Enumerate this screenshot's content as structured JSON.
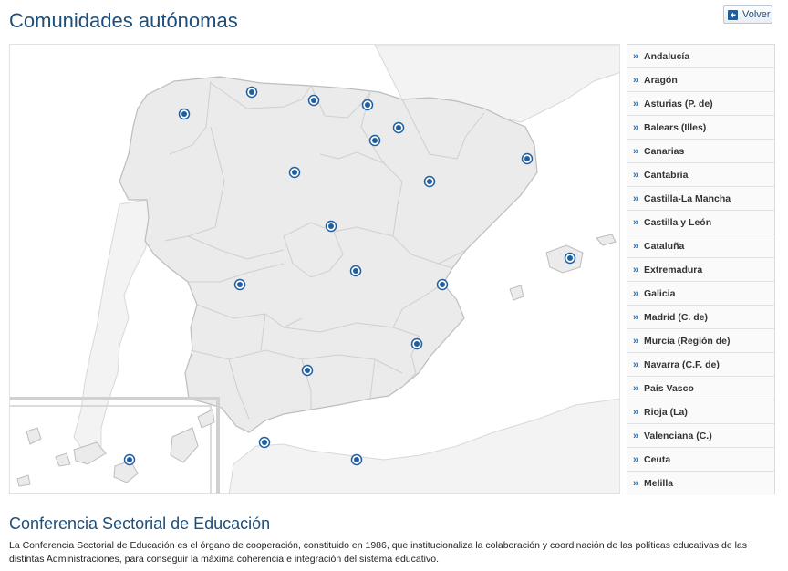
{
  "header": {
    "title": "Comunidades autónomas",
    "back_label": "Volver"
  },
  "map": {
    "markers": [
      {
        "name": "galicia"
      },
      {
        "name": "asturias"
      },
      {
        "name": "cantabria"
      },
      {
        "name": "pais-vasco"
      },
      {
        "name": "navarra"
      },
      {
        "name": "rioja"
      },
      {
        "name": "castilla-y-leon"
      },
      {
        "name": "aragon"
      },
      {
        "name": "cataluna"
      },
      {
        "name": "madrid"
      },
      {
        "name": "castilla-la-mancha"
      },
      {
        "name": "extremadura"
      },
      {
        "name": "valenciana"
      },
      {
        "name": "baleares"
      },
      {
        "name": "murcia"
      },
      {
        "name": "andalucia"
      },
      {
        "name": "canarias"
      },
      {
        "name": "ceuta"
      },
      {
        "name": "melilla"
      }
    ],
    "colors": {
      "land": "#ebebeb",
      "foreign": "#f4f4f4",
      "border": "#c8c8c8",
      "marker": "#1f5f9f"
    }
  },
  "regions": [
    "Andalucía",
    "Aragón",
    "Asturias (P. de)",
    "Balears (Illes)",
    "Canarias",
    "Cantabria",
    "Castilla-La Mancha",
    "Castilla y León",
    "Cataluña",
    "Extremadura",
    "Galicia",
    "Madrid (C. de)",
    "Murcia (Región de)",
    "Navarra (C.F. de)",
    "País Vasco",
    "Rioja (La)",
    "Valenciana (C.)",
    "Ceuta",
    "Melilla"
  ],
  "info": {
    "title": "Conferencia Sectorial de Educación",
    "text": "La Conferencia Sectorial de Educación es el órgano de cooperación, constituido en 1986, que institucionaliza la colaboración y coordinación de las políticas educativas de las distintas Administraciones, para conseguir la máxima coherencia e integración del sistema educativo."
  },
  "accent_color": "#1f4e79"
}
